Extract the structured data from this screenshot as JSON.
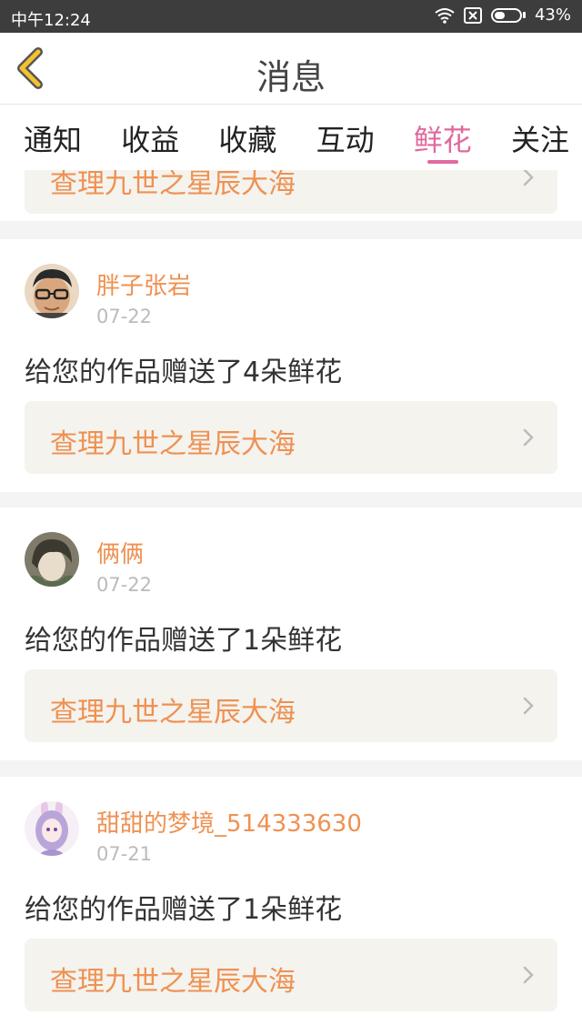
{
  "status_bar": {
    "time": "中午12:24",
    "battery_percent": "43%",
    "battery_level": 0.43,
    "icons": [
      "wifi-icon",
      "sim-icon",
      "battery-icon"
    ]
  },
  "header": {
    "title": "消息",
    "back_icon": "chevron-left-icon"
  },
  "tabs": [
    {
      "label": "通知"
    },
    {
      "label": "收益"
    },
    {
      "label": "收藏"
    },
    {
      "label": "互动"
    },
    {
      "label": "鲜花",
      "active": true
    },
    {
      "label": "关注"
    }
  ],
  "colors": {
    "accent": "#e0699d",
    "name_orange": "#ef9152",
    "back_yellow": "#f3c22f",
    "link_bg": "#f4f3ee"
  },
  "items": [
    {
      "username": "",
      "date": "",
      "message": "",
      "book_title": "查理九世之星辰大海"
    },
    {
      "username": "胖子张岩",
      "date": "07-22",
      "message": "给您的作品赠送了4朵鲜花",
      "book_title": "查理九世之星辰大海",
      "avatar": "avatar-glasses-man"
    },
    {
      "username": "俩俩",
      "date": "07-22",
      "message": "给您的作品赠送了1朵鲜花",
      "book_title": "查理九世之星辰大海",
      "avatar": "avatar-anime-boy"
    },
    {
      "username": "甜甜的梦境_514333630",
      "date": "07-21",
      "message": "给您的作品赠送了1朵鲜花",
      "book_title": "查理九世之星辰大海",
      "avatar": "avatar-anime-girl"
    }
  ]
}
